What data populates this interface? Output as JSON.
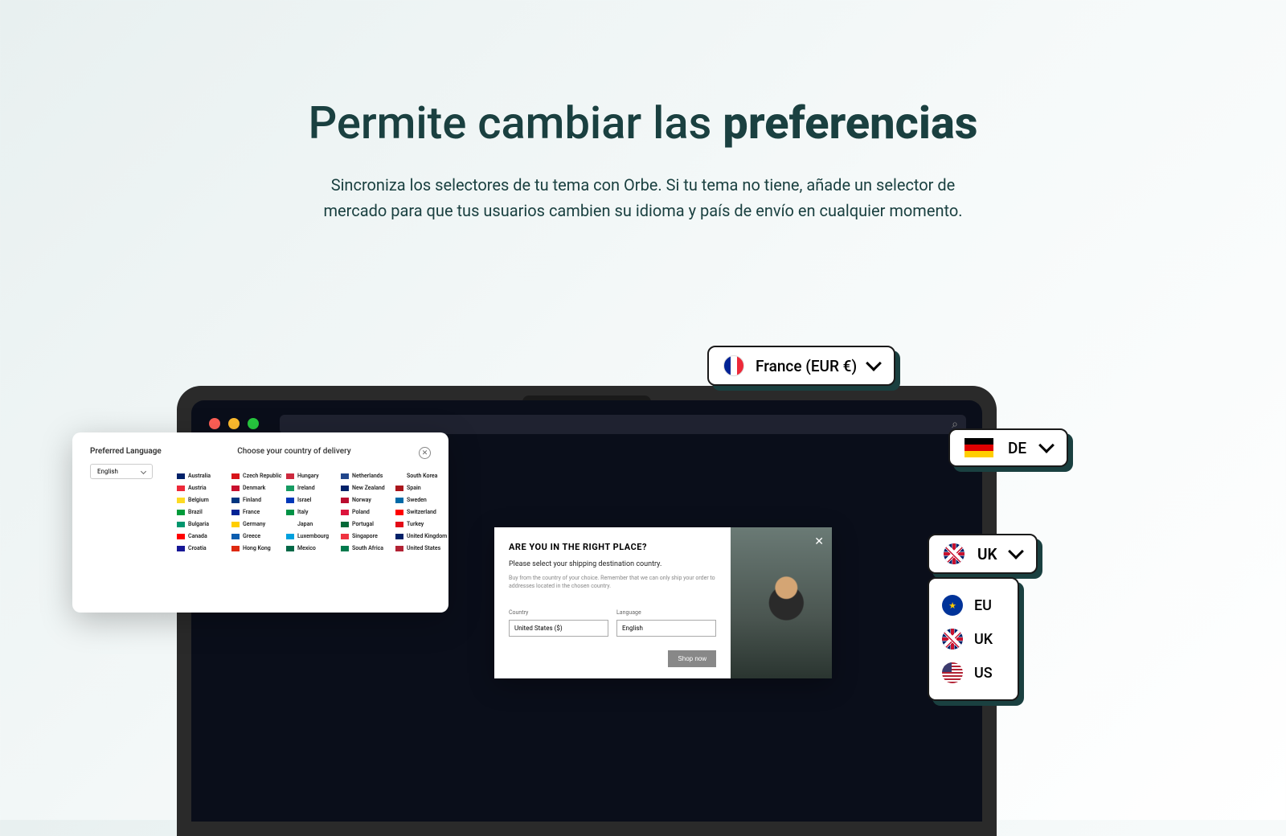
{
  "hero": {
    "title_prefix": "Permite cambiar las ",
    "title_bold": "preferencias",
    "subtitle": "Sincroniza los selectores de tu tema con Orbe. Si tu tema no tiene, añade un selector de mercado para que tus usuarios cambien su idioma y país de envío en cualquier momento."
  },
  "selectors": {
    "france_label": "France (EUR €)",
    "de_label": "DE",
    "uk_label": "UK",
    "dropdown": [
      {
        "code": "EU",
        "flag": "eu"
      },
      {
        "code": "UK",
        "flag": "uk"
      },
      {
        "code": "US",
        "flag": "us"
      }
    ]
  },
  "country_modal": {
    "pref_lang": "Preferred Language",
    "title": "Choose your country of delivery",
    "lang_value": "English",
    "countries": [
      "Australia",
      "Czech Republic",
      "Hungary",
      "Netherlands",
      "South Korea",
      "Austria",
      "Denmark",
      "Ireland",
      "New Zealand",
      "Spain",
      "Belgium",
      "Finland",
      "Israel",
      "Norway",
      "Sweden",
      "Brazil",
      "France",
      "Italy",
      "Poland",
      "Switzerland",
      "Bulgaria",
      "Germany",
      "Japan",
      "Portugal",
      "Turkey",
      "Canada",
      "Greece",
      "Luxembourg",
      "Singapore",
      "United Kingdom",
      "Croatia",
      "Hong Kong",
      "Mexico",
      "South Africa",
      "United States"
    ]
  },
  "popup": {
    "title": "ARE YOU IN THE RIGHT PLACE?",
    "subtitle": "Please select your shipping destination country.",
    "fineprint": "Buy from the country of your choice. Remember that we can only ship your order to addresses located in the chosen country.",
    "country_label": "Country",
    "country_value": "United States ($)",
    "language_label": "Language",
    "language_value": "English",
    "button": "Shop now"
  }
}
